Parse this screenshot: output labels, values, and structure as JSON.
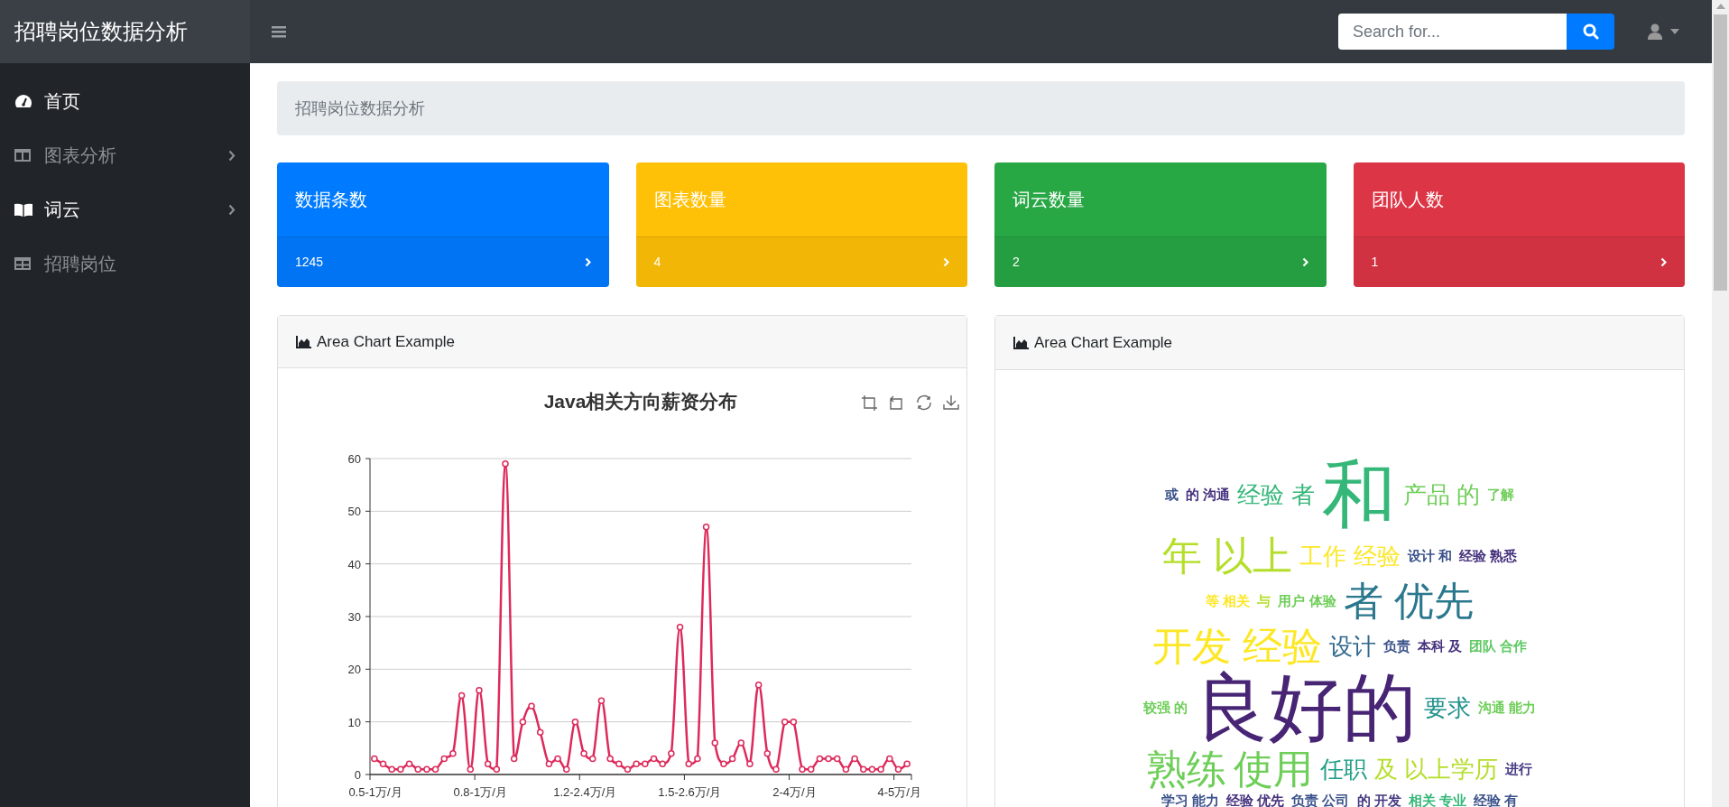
{
  "navbar": {
    "brand": "招聘岗位数据分析",
    "search": {
      "placeholder": "Search for..."
    }
  },
  "sidebar": {
    "items": [
      {
        "label": "首页",
        "kind": "dashboard",
        "active": true,
        "has_submenu": false
      },
      {
        "label": "图表分析",
        "kind": "columns",
        "active": false,
        "has_submenu": true
      },
      {
        "label": "词云",
        "kind": "book",
        "active": true,
        "has_submenu": true
      },
      {
        "label": "招聘岗位",
        "kind": "table",
        "active": false,
        "has_submenu": false
      }
    ]
  },
  "breadcrumb": "招聘岗位数据分析",
  "stat_cards": [
    {
      "label": "数据条数",
      "value": "1245",
      "color": "#007bff"
    },
    {
      "label": "图表数量",
      "value": "4",
      "color": "#ffc107"
    },
    {
      "label": "词云数量",
      "value": "2",
      "color": "#28a745"
    },
    {
      "label": "团队人数",
      "value": "1",
      "color": "#dc3545"
    }
  ],
  "panels": [
    {
      "header": "Area Chart Example",
      "kind": "chart",
      "chart_data": {
        "type": "line",
        "title": "Java相关方向薪资分布",
        "categories": [
          "0.5-1万/月",
          null,
          null,
          null,
          null,
          null,
          null,
          null,
          null,
          null,
          null,
          null,
          "0.8-1万/月",
          null,
          null,
          null,
          null,
          null,
          null,
          null,
          null,
          null,
          null,
          null,
          "1.2-2.4万/月",
          null,
          null,
          null,
          null,
          null,
          null,
          null,
          null,
          null,
          null,
          null,
          "1.5-2.6万/月",
          null,
          null,
          null,
          null,
          null,
          null,
          null,
          null,
          null,
          null,
          null,
          "2-4万/月",
          null,
          null,
          null,
          null,
          null,
          null,
          null,
          null,
          null,
          null,
          null,
          "4-5万/月",
          null
        ],
        "grid": true,
        "series": [
          {
            "color": "#dd2a5b",
            "marker": true,
            "values": [
              3,
              2,
              1,
              1,
              2,
              1,
              1,
              1,
              3,
              4,
              15,
              1,
              16,
              2,
              1,
              59,
              3,
              10,
              13,
              8,
              2,
              3,
              1,
              10,
              4,
              3,
              14,
              3,
              2,
              1,
              2,
              2,
              3,
              2,
              4,
              28,
              2,
              3,
              47,
              6,
              2,
              3,
              6,
              2,
              17,
              4,
              1,
              10,
              10,
              1,
              1,
              3,
              3,
              3,
              1,
              3,
              1,
              1,
              1,
              3,
              1,
              2
            ]
          }
        ],
        "ylim": [
          0,
          60
        ],
        "yticks": [
          0,
          10,
          20,
          30,
          40,
          50,
          60
        ]
      }
    },
    {
      "header": "Area Chart Example",
      "kind": "wordcloud",
      "words": [
        {
          "text": "或",
          "kind": "small",
          "color": "#3b528b"
        },
        {
          "text": "的 沟通",
          "kind": "small",
          "color": "#46327e"
        },
        {
          "text": "经验 者",
          "kind": "medium",
          "color": "#35b779"
        },
        {
          "text": "和",
          "kind": "huge",
          "color": "#35b779"
        },
        {
          "text": "产品 的",
          "kind": "medium",
          "color": "#6ece58"
        },
        {
          "text": "了解",
          "kind": "small",
          "color": "#6ece58"
        },
        {
          "text": "年 以上",
          "kind": "large",
          "color": "#b5de2b"
        },
        {
          "text": "工作 经验",
          "kind": "medium",
          "color": "#fde725"
        },
        {
          "text": "设计 和",
          "kind": "small",
          "color": "#3b528b"
        },
        {
          "text": "经验 熟悉",
          "kind": "small",
          "color": "#46327e"
        },
        {
          "text": "等 相关",
          "kind": "small",
          "color": "#fde725"
        },
        {
          "text": "与",
          "kind": "small",
          "color": "#b5de2b"
        },
        {
          "text": "用户 体验",
          "kind": "small",
          "color": "#6ece58"
        },
        {
          "text": "者 优先",
          "kind": "large",
          "color": "#2a788e"
        },
        {
          "text": "开发 经验",
          "kind": "large",
          "color": "#fde725"
        },
        {
          "text": "设计",
          "kind": "medium",
          "color": "#31688e"
        },
        {
          "text": "负责",
          "kind": "small",
          "color": "#3b528b"
        },
        {
          "text": "本科 及",
          "kind": "small",
          "color": "#46327e"
        },
        {
          "text": "团队 合作",
          "kind": "small",
          "color": "#5ec962"
        },
        {
          "text": "较强 的",
          "kind": "small",
          "color": "#6ece58"
        },
        {
          "text": "良好的",
          "kind": "huge",
          "color": "#482475"
        },
        {
          "text": "要求",
          "kind": "medium",
          "color": "#21918c"
        },
        {
          "text": "沟通 能力",
          "kind": "small",
          "color": "#6ece58"
        },
        {
          "text": "熟练",
          "kind": "large",
          "color": "#6ece58"
        },
        {
          "text": "使用",
          "kind": "large",
          "color": "#6ece58"
        },
        {
          "text": "任职",
          "kind": "medium",
          "color": "#1f9e89"
        },
        {
          "text": "及 以上学历",
          "kind": "medium",
          "color": "#b5de2b"
        },
        {
          "text": "进行",
          "kind": "small",
          "color": "#443983"
        },
        {
          "text": "学习 能力",
          "kind": "small",
          "color": "#3b528b"
        },
        {
          "text": "经验 优先",
          "kind": "small",
          "color": "#46327e"
        },
        {
          "text": "负责 公司",
          "kind": "small",
          "color": "#3b528b"
        },
        {
          "text": "的 开发",
          "kind": "small",
          "color": "#443983"
        },
        {
          "text": "相关 专业",
          "kind": "small",
          "color": "#35b779"
        },
        {
          "text": "经验 有",
          "kind": "small",
          "color": "#3b528b"
        }
      ]
    }
  ]
}
